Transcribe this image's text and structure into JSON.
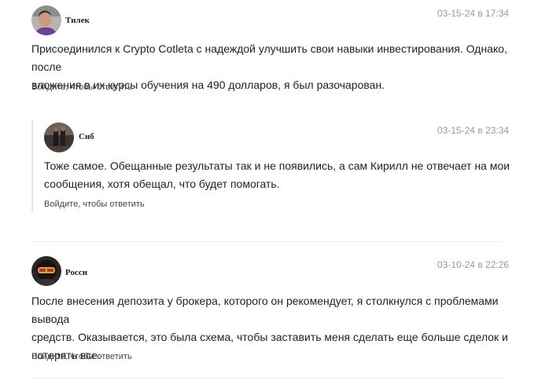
{
  "comments": [
    {
      "author": "Тилек",
      "date": "03-15-24 в 17:34",
      "text_line1": "Присоединился к Crypto Cotleta с надеждой улучшить свои навыки инвестирования. Однако, после",
      "text_line2": "вложения в их курсы обучения на 490 долларов, я был разочарован.",
      "reply": "Войдите, чтобы ответить"
    },
    {
      "author": "Сиб",
      "date": "03-15-24 в 23:34",
      "text_line1": "Тоже самое. Обещанные результаты так и не появились, а сам Кирилл не отвечает на мои",
      "text_line2": "сообщения, хотя обещал, что будет помогать.",
      "reply": "Войдите, чтобы ответить"
    },
    {
      "author": "Росси",
      "date": "03-10-24 в 22:26",
      "text_line1": "После внесения депозита у брокера, которого он рекомендует, я столкнулся с проблемами вывода",
      "text_line2": "средств. Оказывается, это была схема, чтобы заставить меня сделать еще больше сделок и",
      "text_line3": "потерять все.",
      "reply": "Войдите, чтобы ответить"
    }
  ]
}
